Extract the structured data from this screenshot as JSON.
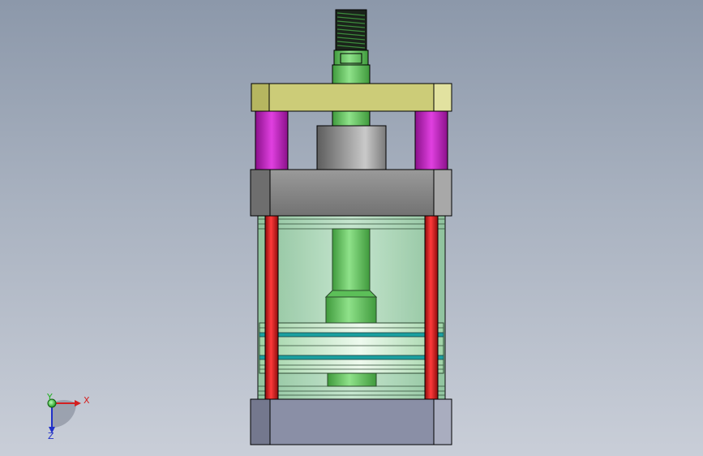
{
  "viewport": {
    "background_top": "#8c98aa",
    "background_bottom": "#c9ced8"
  },
  "axes": {
    "x_label": "X",
    "y_label": "Y",
    "z_label": "Z",
    "x_color": "#d42020",
    "y_color": "#20b020",
    "z_color": "#2030c8"
  },
  "model": {
    "parts": [
      {
        "name": "threaded-stud",
        "color": "#1e2a1e"
      },
      {
        "name": "piston-rod",
        "color": "#6fd06a"
      },
      {
        "name": "top-plate",
        "color": "#cdcd7a"
      },
      {
        "name": "guide-sleeves",
        "color": "#c428c4"
      },
      {
        "name": "rod-bushing",
        "color": "#909090"
      },
      {
        "name": "head-cap",
        "color": "#8a8a8a"
      },
      {
        "name": "cylinder-barrel",
        "color": "#a8d8b4"
      },
      {
        "name": "tie-rods",
        "color": "#d01818"
      },
      {
        "name": "piston",
        "color": "#c8ecc8"
      },
      {
        "name": "base-cap",
        "color": "#8a8fa6"
      }
    ]
  }
}
